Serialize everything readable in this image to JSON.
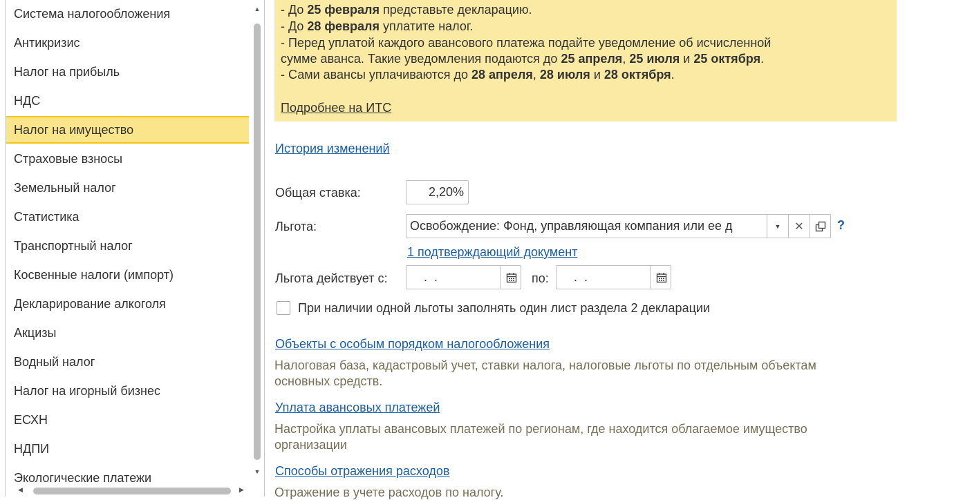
{
  "sidebar": {
    "items": [
      {
        "label": "Система налогообложения"
      },
      {
        "label": "Антикризис"
      },
      {
        "label": "Налог на прибыль"
      },
      {
        "label": "НДС"
      },
      {
        "label": "Налог на имущество",
        "selected": true
      },
      {
        "label": "Страховые взносы"
      },
      {
        "label": "Земельный налог"
      },
      {
        "label": "Статистика"
      },
      {
        "label": "Транспортный налог"
      },
      {
        "label": "Косвенные налоги (импорт)"
      },
      {
        "label": "Декларирование алкоголя"
      },
      {
        "label": "Акцизы"
      },
      {
        "label": "Водный налог"
      },
      {
        "label": "Налог на игорный бизнес"
      },
      {
        "label": "ЕСХН"
      },
      {
        "label": "НДПИ"
      },
      {
        "label": "Экологические платежи"
      }
    ],
    "selected_color": "#fbe58b",
    "selected_border": "#f5c518"
  },
  "notice": {
    "line1_prefix": " - До ",
    "line1_bold": "25 февраля",
    "line1_suffix": " представьте декларацию.",
    "line2_prefix": " - До ",
    "line2_bold": "28 февраля",
    "line2_suffix": " уплатите налог.",
    "line3": " - Перед уплатой каждого авансового платежа подайте уведомление об исчисленной",
    "line4_prefix": "сумме аванса. Такие уведомления подаются до ",
    "line4_b1": "25 апреля",
    "line4_s1": ", ",
    "line4_b2": "25 июля",
    "line4_s2": " и ",
    "line4_b3": "25 октября",
    "line4_s3": ".",
    "line5_prefix": " - Сами авансы уплачиваются до ",
    "line5_b1": "28 апреля",
    "line5_s1": ", ",
    "line5_b2": "28 июля",
    "line5_s2": " и ",
    "line5_b3": "28 октября",
    "line5_s3": ".",
    "its_link": "Подробнее на ИТС",
    "background": "#fbeaa3"
  },
  "history_link": "История изменений",
  "form": {
    "rate_label": "Общая ставка:",
    "rate_value": "2,20%",
    "benefit_label": "Льгота:",
    "benefit_value": "Освобождение: Фонд, управляющая компания или ее д",
    "help_mark": "?",
    "docs_link": "1 подтверждающий документ",
    "valid_from_label": "Льгота действует с:",
    "valid_from_value": " .  .",
    "valid_to_label": "по:",
    "valid_to_value": " .  .",
    "checkbox_label": "При наличии одной льготы заполнять один лист раздела 2 декларации",
    "checkbox_checked": false
  },
  "sections": [
    {
      "link": "Объекты с особым порядком налогообложения",
      "desc1": "Налоговая база, кадастровый учет, ставки налога, налоговые льготы по отдельным объектам",
      "desc2": "основных средств."
    },
    {
      "link": "Уплата авансовых платежей",
      "desc1": "Настройка уплаты авансовых платежей по регионам, где находится облагаемое имущество",
      "desc2": "организации"
    },
    {
      "link": "Способы отражения расходов",
      "desc1": "Отражение в учете расходов по налогу."
    }
  ],
  "colors": {
    "link": "#1b5ea4",
    "desc": "#777056"
  }
}
